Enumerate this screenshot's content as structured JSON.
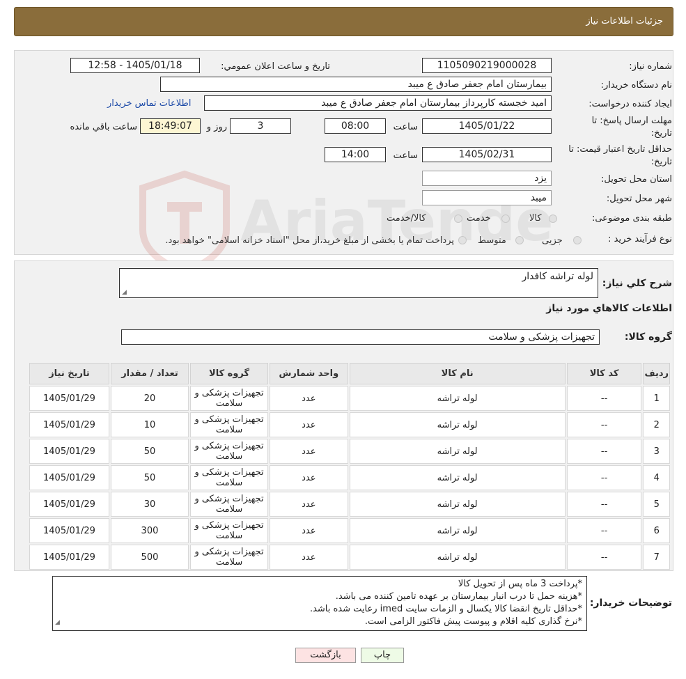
{
  "header": {
    "title": "جزئیات اطلاعات نیاز"
  },
  "form": {
    "need_number_label": "شماره نیاز:",
    "need_number": "1105090219000028",
    "announce_label": "تاریخ و ساعت اعلان عمومي:",
    "announce_value": "1405/01/18 - 12:58",
    "buyer_org_label": "نام دستگاه خريدار:",
    "buyer_org": "بیمارستان امام جعفر صادق  ع  میبد",
    "creator_label": "ايجاد كننده درخواست:",
    "creator": "امید خجسته کارپرداز بیمارستان امام جعفر صادق  ع  میبد",
    "contact_link": "اطلاعات تماس خريدار",
    "deadline_label_1": "مهلت ارسال پاسخ: تا",
    "deadline_label_2": "تاريخ:",
    "deadline_date": "1405/01/22",
    "time_label": "ساعت",
    "deadline_time": "08:00",
    "days_value": "3",
    "days_label": "روز و",
    "remaining_time": "18:49:07",
    "remaining_label": "ساعت باقي مانده",
    "validity_label_1": "حداقل تاريخ اعتبار قيمت: تا",
    "validity_label_2": "تاريخ:",
    "validity_date": "1405/02/31",
    "validity_time": "14:00",
    "province_label": "استان محل تحويل:",
    "province": "یزد",
    "city_label": "شهر محل تحويل:",
    "city": "میبد",
    "category_label": "طبقه بندی موضوعی:",
    "category_options": [
      "کالا",
      "خدمت",
      "کالا/خدمت"
    ],
    "purchase_type_label": "نوع فرآیند خرید :",
    "purchase_options": [
      "جزیی",
      "متوسط"
    ],
    "purchase_note": "پرداخت تمام یا بخشی از مبلغ خرید،از محل \"اسناد خزانه اسلامی\" خواهد بود."
  },
  "details": {
    "summary_label": "شرح كلي نياز:",
    "summary": "لوله تراشه کافدار",
    "goods_info_title": "اطلاعات کالاهاي مورد نياز",
    "group_label": "گروه کالا:",
    "group_value": "تجهیزات پزشکی و سلامت"
  },
  "table": {
    "headers": [
      "رديف",
      "کد کالا",
      "نام کالا",
      "واحد شمارش",
      "گروه کالا",
      "تعداد / مقدار",
      "تاريخ نياز"
    ],
    "rows": [
      {
        "n": "1",
        "code": "--",
        "name": "لوله تراشه",
        "unit": "عدد",
        "group": "تجهیزات پزشکی و سلامت",
        "qty": "20",
        "date": "1405/01/29"
      },
      {
        "n": "2",
        "code": "--",
        "name": "لوله تراشه",
        "unit": "عدد",
        "group": "تجهیزات پزشکی و سلامت",
        "qty": "10",
        "date": "1405/01/29"
      },
      {
        "n": "3",
        "code": "--",
        "name": "لوله تراشه",
        "unit": "عدد",
        "group": "تجهیزات پزشکی و سلامت",
        "qty": "50",
        "date": "1405/01/29"
      },
      {
        "n": "4",
        "code": "--",
        "name": "لوله تراشه",
        "unit": "عدد",
        "group": "تجهیزات پزشکی و سلامت",
        "qty": "50",
        "date": "1405/01/29"
      },
      {
        "n": "5",
        "code": "--",
        "name": "لوله تراشه",
        "unit": "عدد",
        "group": "تجهیزات پزشکی و سلامت",
        "qty": "30",
        "date": "1405/01/29"
      },
      {
        "n": "6",
        "code": "--",
        "name": "لوله تراشه",
        "unit": "عدد",
        "group": "تجهیزات پزشکی و سلامت",
        "qty": "300",
        "date": "1405/01/29"
      },
      {
        "n": "7",
        "code": "--",
        "name": "لوله تراشه",
        "unit": "عدد",
        "group": "تجهیزات پزشکی و سلامت",
        "qty": "500",
        "date": "1405/01/29"
      }
    ]
  },
  "notes": {
    "label": "توضيحات خريدار:",
    "lines": [
      "*پرداخت 3 ماه پس از تحویل کالا",
      "*هزینه حمل تا درب انبار بیمارستان بر عهده تامین کننده می باشد.",
      "*حداقل تاریخ انقضا کالا یکسال و الزمات سایت imed رعایت شده باشد.",
      "*نرخ گذاری کلیه اقلام و پیوست پیش فاکتور الزامی است."
    ]
  },
  "buttons": {
    "print": "چاپ",
    "back": "بازگشت"
  },
  "watermark": "AriaTender.neT",
  "colors": {
    "header_bg": "#8a6d3b",
    "link": "#1f4ca8",
    "back_button_bg": "#fde3e3",
    "print_button_bg": "#eefbe6"
  }
}
